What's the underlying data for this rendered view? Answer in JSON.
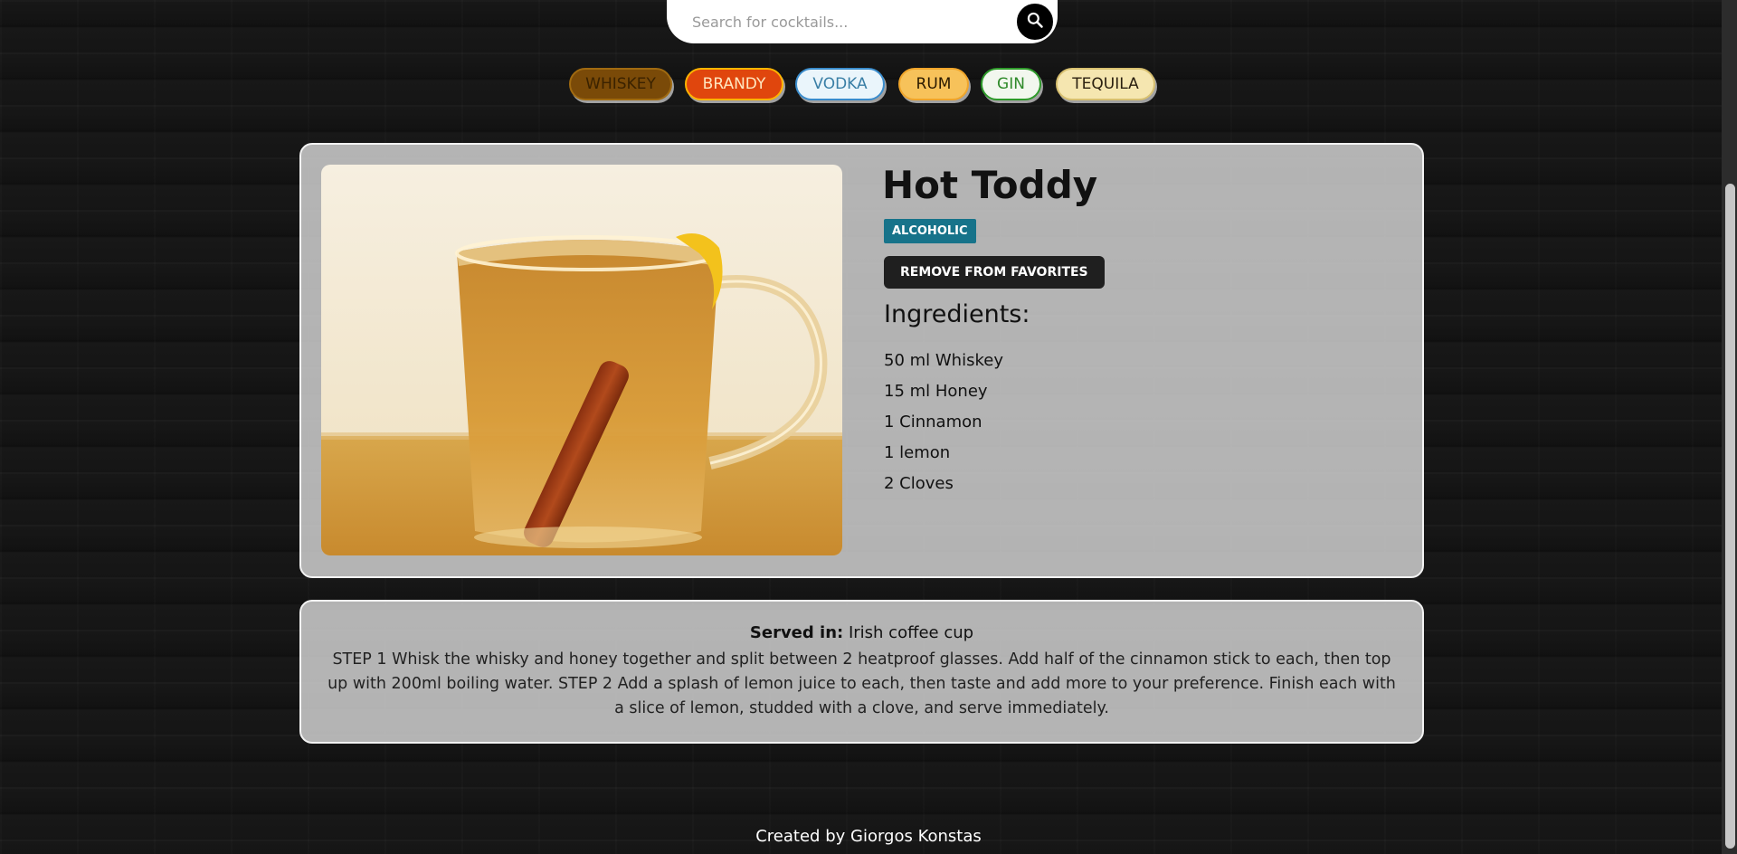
{
  "search": {
    "placeholder": "Search for cocktails..."
  },
  "categories": [
    {
      "label": "WHISKEY",
      "bg": "#7a4a08",
      "fg": "#3a2200",
      "border": "#a06a10"
    },
    {
      "label": "BRANDY",
      "bg": "#e0460d",
      "fg": "#ffe7c0",
      "border": "#ffb400"
    },
    {
      "label": "VODKA",
      "bg": "#eaf5fb",
      "fg": "#3a7fa6",
      "border": "#3a8ccc"
    },
    {
      "label": "RUM",
      "bg": "#f7c25a",
      "fg": "#2b1a00",
      "border": "#f0a52a"
    },
    {
      "label": "GIN",
      "bg": "#f2f7ee",
      "fg": "#2f8a2a",
      "border": "#2e9a2a"
    },
    {
      "label": "TEQUILA",
      "bg": "#f5e6b0",
      "fg": "#2b2010",
      "border": "#d8c070"
    }
  ],
  "cocktail": {
    "name": "Hot Toddy",
    "type": "ALCOHOLIC",
    "favorite_button": "REMOVE FROM FAVORITES",
    "ingredients_title": "Ingredients:",
    "ingredients": [
      "50 ml Whiskey",
      "15 ml Honey",
      "1 Cinnamon",
      "1 lemon",
      "2 Cloves"
    ],
    "served_label": "Served in:",
    "glass": "Irish coffee cup",
    "instructions": "STEP 1 Whisk the whisky and honey together and split between 2 heatproof glasses. Add half of the cinnamon stick to each, then top up with 200ml boiling water. STEP 2 Add a splash of lemon juice to each, then taste and add more to your preference. Finish each with a slice of lemon, studded with a clove, and serve immediately."
  },
  "footer": "Created by Giorgos Konstas",
  "colors": {
    "badge": "#17738a",
    "button": "#1f1f1f"
  }
}
